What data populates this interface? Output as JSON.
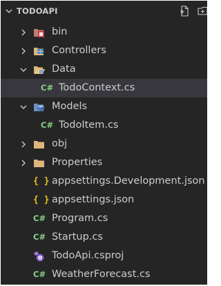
{
  "explorer": {
    "title": "TODOAPI",
    "header_actions": [
      {
        "icon": "new-file-icon"
      },
      {
        "icon": "new-folder-icon"
      }
    ]
  },
  "tree": [
    {
      "label": "bin",
      "type": "folder",
      "expanded": false,
      "icon": "folder-bin-icon"
    },
    {
      "label": "Controllers",
      "type": "folder",
      "expanded": false,
      "icon": "folder-controllers-icon"
    },
    {
      "label": "Data",
      "type": "folder",
      "expanded": true,
      "icon": "folder-open-icon"
    },
    {
      "label": "TodoContext.cs",
      "type": "file",
      "icon": "csharp-file-icon",
      "glyph": "C#",
      "selected": true
    },
    {
      "label": "Models",
      "type": "folder",
      "expanded": true,
      "icon": "folder-models-icon"
    },
    {
      "label": "TodoItem.cs",
      "type": "file",
      "icon": "csharp-file-icon",
      "glyph": "C#"
    },
    {
      "label": "obj",
      "type": "folder",
      "expanded": false,
      "icon": "folder-icon"
    },
    {
      "label": "Properties",
      "type": "folder",
      "expanded": false,
      "icon": "folder-icon"
    },
    {
      "label": "appsettings.Development.json",
      "type": "file",
      "icon": "json-file-icon",
      "glyph": "{ }"
    },
    {
      "label": "appsettings.json",
      "type": "file",
      "icon": "json-file-icon",
      "glyph": "{ }"
    },
    {
      "label": "Program.cs",
      "type": "file",
      "icon": "csharp-file-icon",
      "glyph": "C#"
    },
    {
      "label": "Startup.cs",
      "type": "file",
      "icon": "csharp-file-icon",
      "glyph": "C#"
    },
    {
      "label": "TodoApi.csproj",
      "type": "file",
      "icon": "csproj-file-icon"
    },
    {
      "label": "WeatherForecast.cs",
      "type": "file",
      "icon": "csharp-file-icon",
      "glyph": "C#"
    }
  ],
  "colors": {
    "sidebar_background": "#252526",
    "selected_row": "#37373d",
    "text": "#cccccc",
    "csharp_icon": "#89d185",
    "json_icon": "#e8c31d",
    "folder": "#dcb67a"
  }
}
